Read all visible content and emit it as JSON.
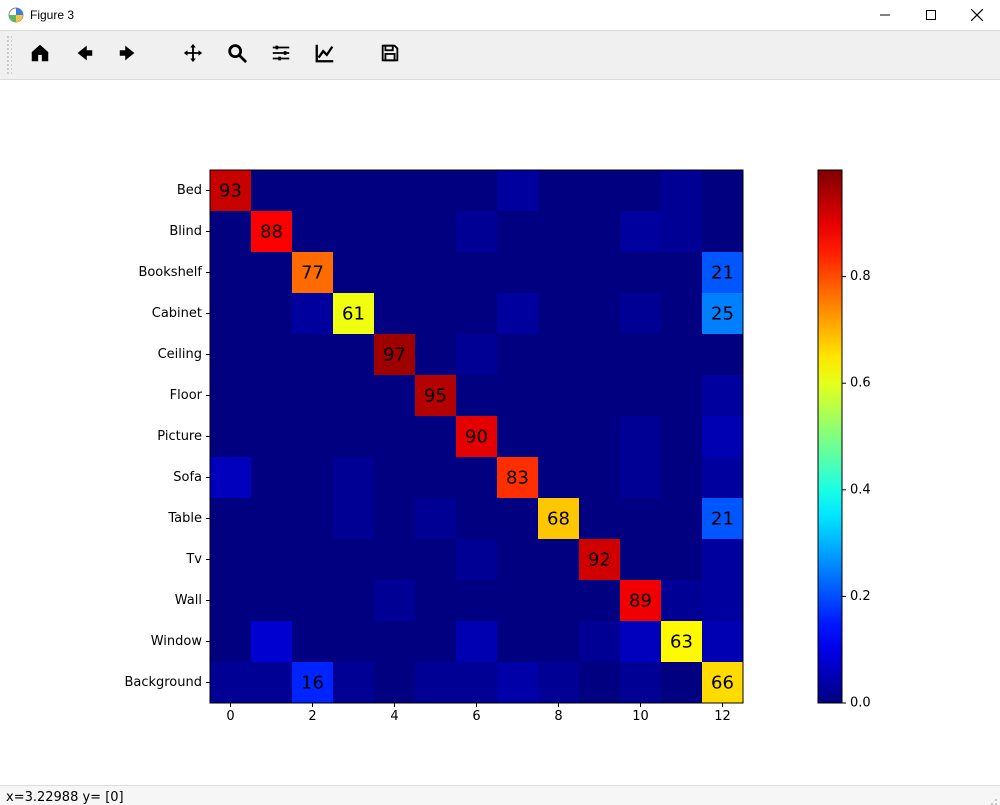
{
  "window": {
    "title": "Figure 3"
  },
  "toolbar": {
    "home": "Home",
    "back": "Back",
    "forward": "Forward",
    "pan": "Pan",
    "zoom": "Zoom",
    "subplots": "Configure subplots",
    "customize": "Edit axis",
    "save": "Save"
  },
  "status": {
    "text": "x=3.22988     y= [0]"
  },
  "chart_data": {
    "type": "heatmap",
    "rows": [
      "Bed",
      "Blind",
      "Bookshelf",
      "Cabinet",
      "Ceiling",
      "Floor",
      "Picture",
      "Sofa",
      "Table",
      "Tv",
      "Wall",
      "Window",
      "Background"
    ],
    "x_ticks": [
      0,
      2,
      4,
      6,
      8,
      10,
      12
    ],
    "colorbar_ticks": [
      0.0,
      0.2,
      0.4,
      0.6,
      0.8
    ],
    "colorbar_range": [
      0.0,
      1.0
    ],
    "matrix": [
      [
        0.93,
        0.0,
        0.0,
        0.0,
        0.0,
        0.0,
        0.0,
        0.03,
        0.0,
        0.0,
        0.0,
        0.02,
        0.0
      ],
      [
        0.0,
        0.88,
        0.0,
        0.0,
        0.0,
        0.0,
        0.02,
        0.0,
        0.0,
        0.0,
        0.03,
        0.02,
        0.0
      ],
      [
        0.0,
        0.0,
        0.77,
        0.0,
        0.0,
        0.0,
        0.0,
        0.0,
        0.0,
        0.0,
        0.0,
        0.0,
        0.21
      ],
      [
        0.0,
        0.0,
        0.03,
        0.61,
        0.0,
        0.0,
        0.0,
        0.03,
        0.0,
        0.0,
        0.02,
        0.0,
        0.25
      ],
      [
        0.0,
        0.0,
        0.0,
        0.0,
        0.97,
        0.0,
        0.02,
        0.0,
        0.0,
        0.0,
        0.0,
        0.0,
        0.0
      ],
      [
        0.0,
        0.0,
        0.0,
        0.0,
        0.0,
        0.95,
        0.0,
        0.0,
        0.0,
        0.0,
        0.0,
        0.0,
        0.03
      ],
      [
        0.0,
        0.0,
        0.0,
        0.0,
        0.0,
        0.0,
        0.9,
        0.0,
        0.0,
        0.0,
        0.02,
        0.0,
        0.05
      ],
      [
        0.06,
        0.0,
        0.0,
        0.02,
        0.0,
        0.0,
        0.0,
        0.83,
        0.0,
        0.0,
        0.02,
        0.0,
        0.03
      ],
      [
        0.0,
        0.0,
        0.0,
        0.02,
        0.0,
        0.02,
        0.0,
        0.0,
        0.68,
        0.0,
        0.0,
        0.0,
        0.21
      ],
      [
        0.0,
        0.0,
        0.0,
        0.0,
        0.0,
        0.0,
        0.02,
        0.0,
        0.0,
        0.92,
        0.0,
        0.0,
        0.03
      ],
      [
        0.0,
        0.0,
        0.0,
        0.0,
        0.02,
        0.0,
        0.0,
        0.0,
        0.0,
        0.0,
        0.89,
        0.02,
        0.03
      ],
      [
        0.0,
        0.08,
        0.0,
        0.0,
        0.0,
        0.0,
        0.05,
        0.0,
        0.0,
        0.02,
        0.06,
        0.63,
        0.05
      ],
      [
        0.02,
        0.02,
        0.16,
        0.02,
        0.0,
        0.02,
        0.02,
        0.04,
        0.02,
        0.0,
        0.02,
        0.0,
        0.66
      ]
    ],
    "annotations": [
      {
        "r": 0,
        "c": 0,
        "text": "93"
      },
      {
        "r": 1,
        "c": 1,
        "text": "88"
      },
      {
        "r": 2,
        "c": 2,
        "text": "77"
      },
      {
        "r": 2,
        "c": 12,
        "text": "21"
      },
      {
        "r": 3,
        "c": 3,
        "text": "61"
      },
      {
        "r": 3,
        "c": 12,
        "text": "25"
      },
      {
        "r": 4,
        "c": 4,
        "text": "97"
      },
      {
        "r": 5,
        "c": 5,
        "text": "95"
      },
      {
        "r": 6,
        "c": 6,
        "text": "90"
      },
      {
        "r": 7,
        "c": 7,
        "text": "83"
      },
      {
        "r": 8,
        "c": 8,
        "text": "68"
      },
      {
        "r": 8,
        "c": 12,
        "text": "21"
      },
      {
        "r": 9,
        "c": 9,
        "text": "92"
      },
      {
        "r": 10,
        "c": 10,
        "text": "89"
      },
      {
        "r": 11,
        "c": 11,
        "text": "63"
      },
      {
        "r": 12,
        "c": 2,
        "text": "16"
      },
      {
        "r": 12,
        "c": 12,
        "text": "66"
      }
    ]
  }
}
